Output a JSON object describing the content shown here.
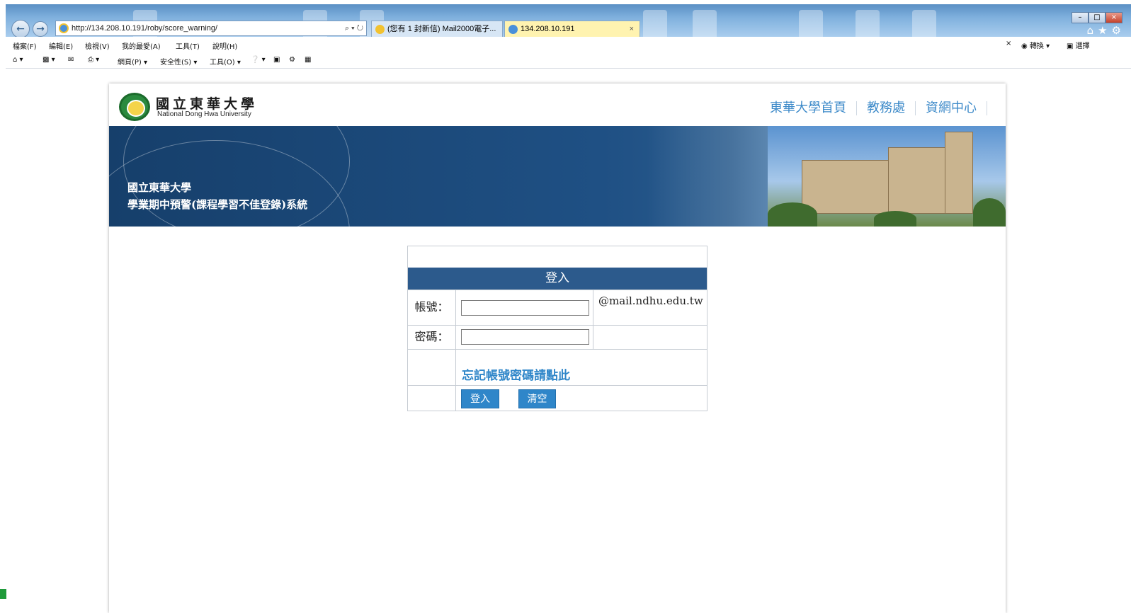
{
  "browser": {
    "address_url": "http://134.208.10.191/roby/score_warning/",
    "address_tools": "⌕ ▾ ↻",
    "tabs": [
      {
        "label": "(您有 1 封新信) Mail2000電子..."
      },
      {
        "label": "134.208.10.191",
        "close": "×"
      }
    ],
    "menu": [
      "檔案(F)",
      "編輯(E)",
      "檢視(V)",
      "我的最愛(A)",
      "工具(T)",
      "說明(H)"
    ],
    "menu_right": {
      "close": "×",
      "convert": "轉換",
      "select": "選擇"
    },
    "commands": [
      "網頁(P) ▾",
      "安全性(S) ▾",
      "工具(O) ▾"
    ]
  },
  "header": {
    "logo_cn": "國立東華大學",
    "logo_en": "National Dong Hwa University",
    "links": [
      "東華大學首頁",
      "教務處",
      "資網中心"
    ]
  },
  "banner": {
    "line1": "國立東華大學",
    "line2": "學業期中預警(課程學習不佳登錄)系統"
  },
  "login": {
    "title": "登入",
    "account_label": "帳號：",
    "account_value": "",
    "account_suffix": "@mail.ndhu.edu.tw",
    "password_label": "密碼：",
    "password_value": "",
    "forgot_link": "忘記帳號密碼請點此",
    "login_button": "登入",
    "clear_button": "清空"
  },
  "colors": {
    "banner": "#1f5084",
    "login_header": "#2c5a8c",
    "button": "#2f86c9",
    "link": "#3d8ac9"
  }
}
